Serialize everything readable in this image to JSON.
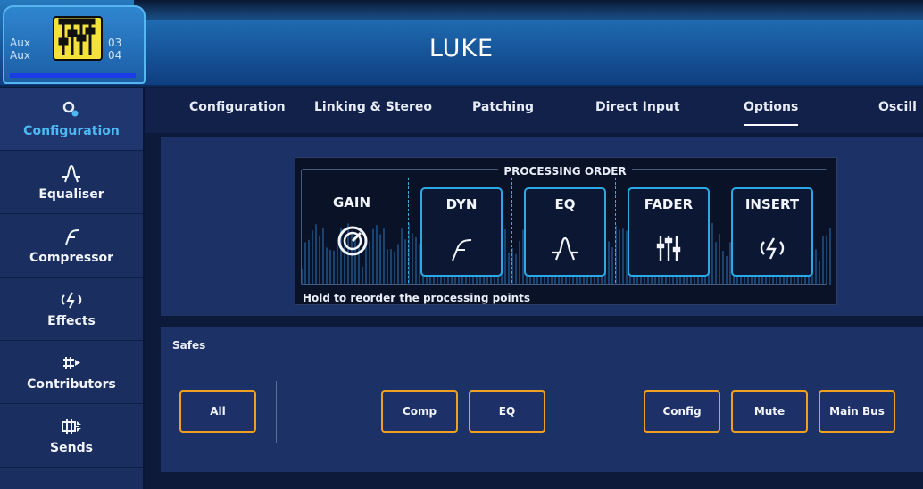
{
  "header": {
    "channel_title": "LUKE",
    "channel_tab": {
      "aux_top": "Aux",
      "aux_bottom": "Aux",
      "num_top": "03",
      "num_bottom": "04"
    }
  },
  "sidebar": {
    "items": [
      {
        "label": "Configuration",
        "icon": "configuration-gear-icon",
        "active": true
      },
      {
        "label": "Equaliser",
        "icon": "eq-curve-icon"
      },
      {
        "label": "Compressor",
        "icon": "compressor-curve-icon"
      },
      {
        "label": "Effects",
        "icon": "effects-icon"
      },
      {
        "label": "Contributors",
        "icon": "contributors-icon"
      },
      {
        "label": "Sends",
        "icon": "sends-icon"
      }
    ]
  },
  "tabs": [
    {
      "label": "Configuration"
    },
    {
      "label": "Linking & Stereo"
    },
    {
      "label": "Patching"
    },
    {
      "label": "Direct Input"
    },
    {
      "label": "Options",
      "active": true
    },
    {
      "label": "Oscill"
    }
  ],
  "processing_order": {
    "title": "PROCESSING ORDER",
    "hint": "Hold to reorder the processing points",
    "gain_label": "GAIN",
    "blocks": [
      {
        "label": "DYN",
        "icon": "dynamics-curve-icon"
      },
      {
        "label": "EQ",
        "icon": "eq-curve-icon"
      },
      {
        "label": "FADER",
        "icon": "fader-icon"
      },
      {
        "label": "INSERT",
        "icon": "insert-icon"
      }
    ]
  },
  "safes": {
    "title": "Safes",
    "buttons": [
      "All",
      "Comp",
      "EQ",
      "Config",
      "Mute",
      "Main Bus"
    ]
  },
  "colors": {
    "accent_blue": "#2aa9e6",
    "active_label": "#4fb8f3",
    "safe_border": "#f0a020",
    "badge_yellow": "#f2e23a"
  }
}
